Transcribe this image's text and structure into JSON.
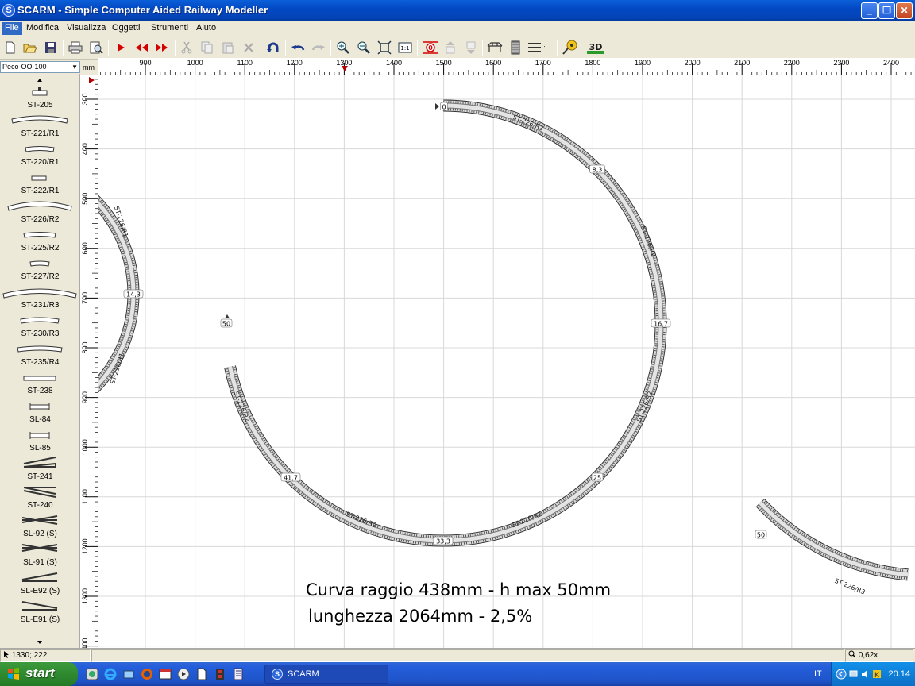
{
  "window": {
    "app_icon": "S",
    "title": "SCARM - Simple Computer Aided Railway Modeller",
    "buttons": {
      "minimize": "_",
      "maximize": "❐",
      "close": "✕"
    }
  },
  "menu": [
    {
      "label": "File",
      "active": true
    },
    {
      "label": "Modifica"
    },
    {
      "label": "Visualizza"
    },
    {
      "label": "Oggetti"
    },
    {
      "label": "Strumenti"
    },
    {
      "label": "Aiuto"
    }
  ],
  "toolbar": {
    "icons": [
      "new-icon",
      "open-icon",
      "save-icon",
      "print-icon",
      "print-preview-icon",
      "select-icon",
      "move-left-icon",
      "move-right-icon",
      "cut-icon",
      "copy-icon",
      "paste-icon",
      "delete-icon",
      "rotate-icon",
      "undo-icon",
      "redo-icon",
      "zoom-in-icon",
      "zoom-out-icon",
      "zoom-fit-icon",
      "zoom-1to1-icon",
      "track-height-icon",
      "raise-icon",
      "lower-icon",
      "bridge-icon",
      "tunnel-icon",
      "layers-icon",
      "measure-icon",
      "view-3d-icon"
    ],
    "view3d_label": "3D",
    "zoom11_label": "1:1"
  },
  "library": {
    "selected": "Peco-OO-100",
    "items": [
      "ST-205",
      "ST-221/R1",
      "ST-220/R1",
      "ST-222/R1",
      "ST-226/R2",
      "ST-225/R2",
      "ST-227/R2",
      "ST-231/R3",
      "ST-230/R3",
      "ST-235/R4",
      "ST-238",
      "SL-84",
      "SL-85",
      "ST-241",
      "ST-240",
      "SL-92 (S)",
      "SL-91 (S)",
      "SL-E92 (S)",
      "SL-E91 (S)"
    ]
  },
  "rulers": {
    "unit": "mm",
    "h_labels": [
      "900",
      "1000",
      "1100",
      "1200",
      "1300",
      "1400",
      "1500",
      "1600",
      "1700",
      "1800",
      "1900",
      "2000",
      "2100",
      "2200",
      "2300",
      "2400"
    ],
    "v_labels": [
      "300",
      "400",
      "500",
      "600",
      "700",
      "800",
      "900",
      "1000",
      "1100",
      "1200",
      "1300",
      "1400"
    ]
  },
  "canvas": {
    "annotation_line1": "Curva raggio 438mm - h max 50mm",
    "annotation_line2": "lunghezza 2064mm - 2,5%",
    "height_markers": [
      "0",
      "8,3",
      "16,7",
      "25",
      "33,3",
      "41,7",
      "50",
      "14,3",
      "50"
    ],
    "track_labels": [
      "ST-226/R2",
      "ST-226/R2",
      "ST-226/R2",
      "ST-226/R2",
      "ST-226/R2",
      "ST-226/R2",
      "ST-226/R1",
      "ST-226/R1",
      "ST-226/R3"
    ]
  },
  "status": {
    "coords": "1330; 222",
    "zoom": "0,62x"
  },
  "taskbar": {
    "start": "start",
    "task": "SCARM",
    "lang": "IT",
    "clock": "20.14"
  }
}
